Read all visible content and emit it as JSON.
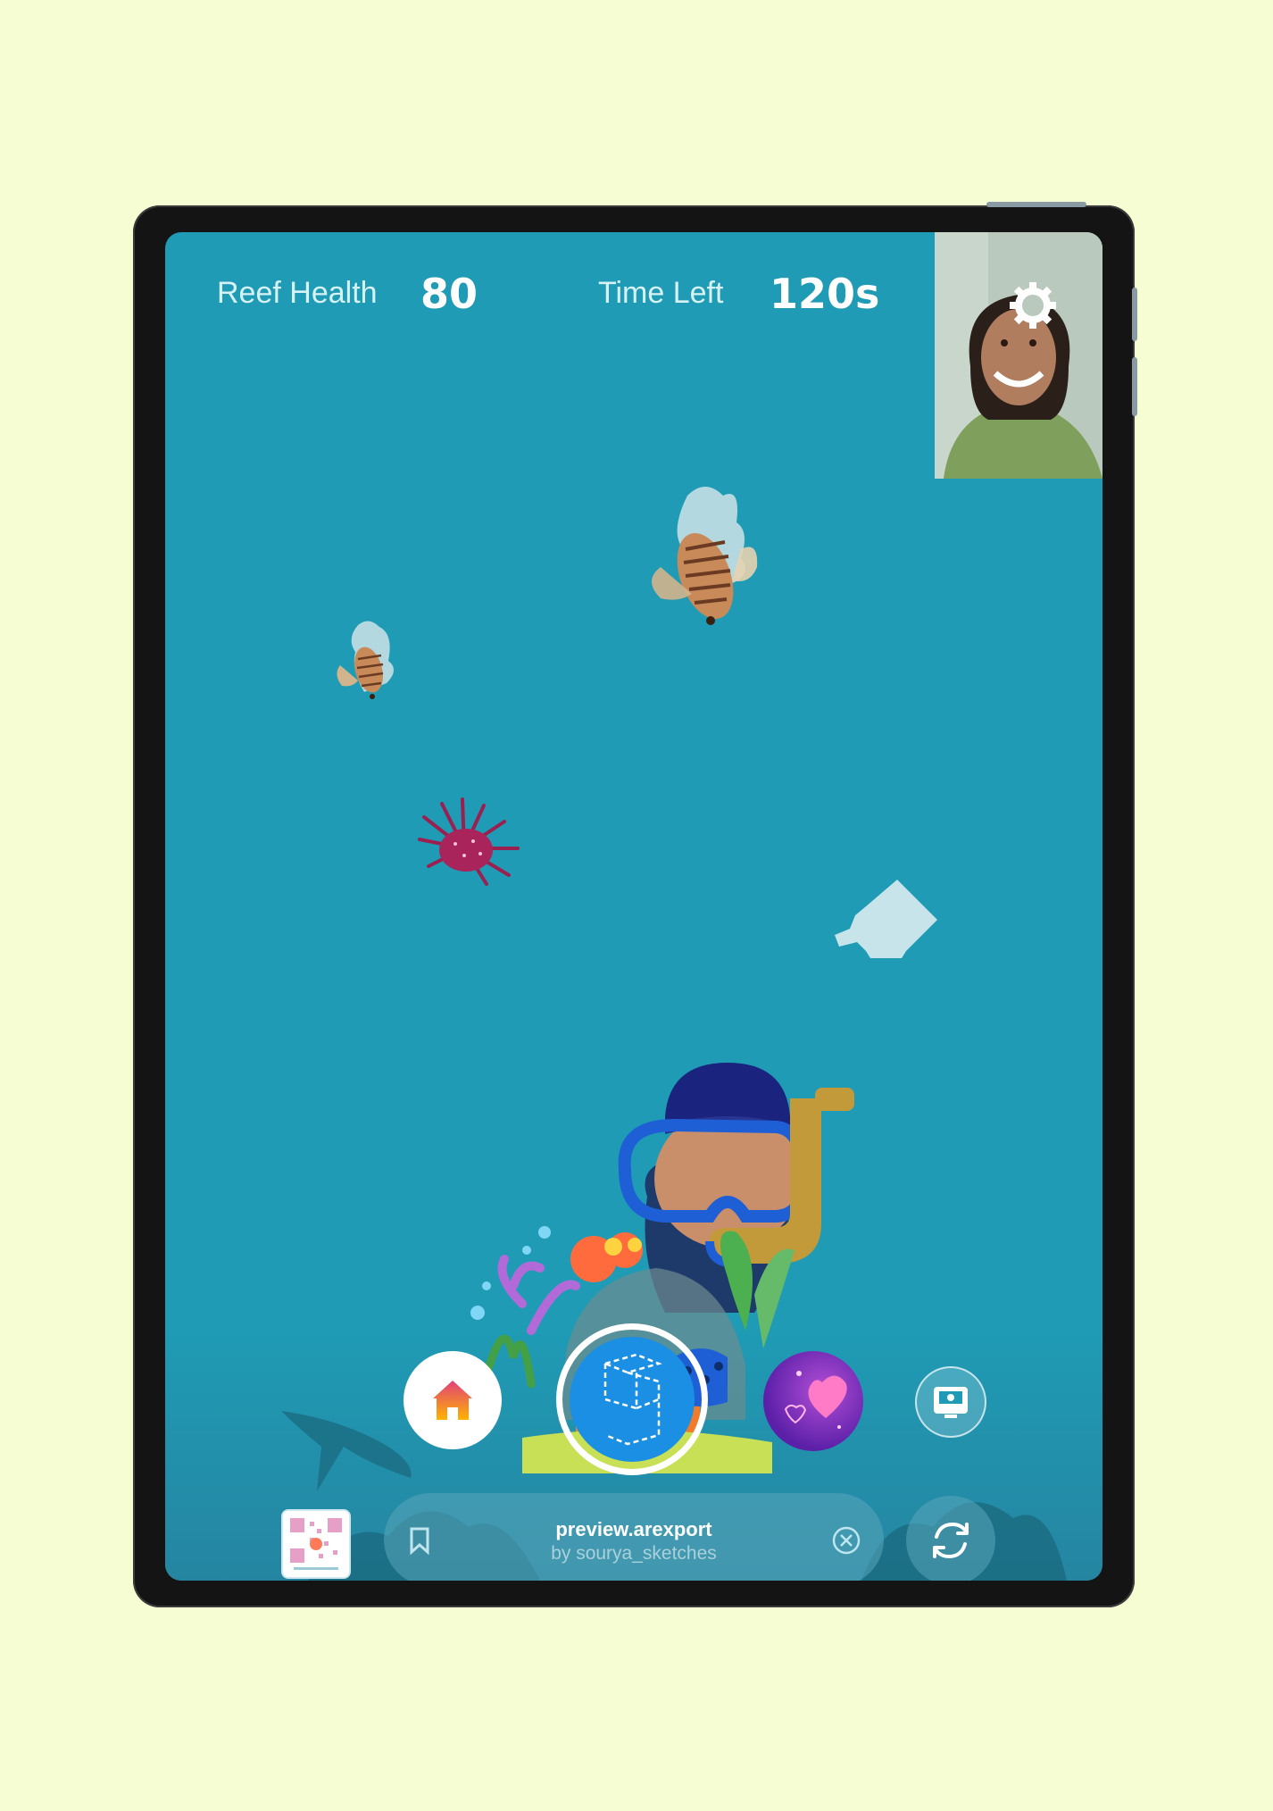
{
  "hud": {
    "reef_health_label": "Reef Health",
    "reef_health_value": "80",
    "time_left_label": "Time Left",
    "time_left_value": "120s"
  },
  "effect": {
    "url": "preview.arexport",
    "author": "by sourya_sketches"
  },
  "icons": {
    "settings": "gear-icon",
    "home": "home-icon",
    "capture": "effect-logo-icon",
    "bookmark": "bookmark-icon",
    "close": "close-icon",
    "flip_camera": "flip-camera-icon",
    "camera_roll": "camera-icon"
  },
  "colors": {
    "background": "#f7fdd3",
    "water": "#1f9bb5",
    "capture_ring": "#ffffff",
    "capture_fill": "#1a8fe3",
    "home_gradient_start": "#ffb300",
    "home_gradient_end": "#e0407a"
  }
}
